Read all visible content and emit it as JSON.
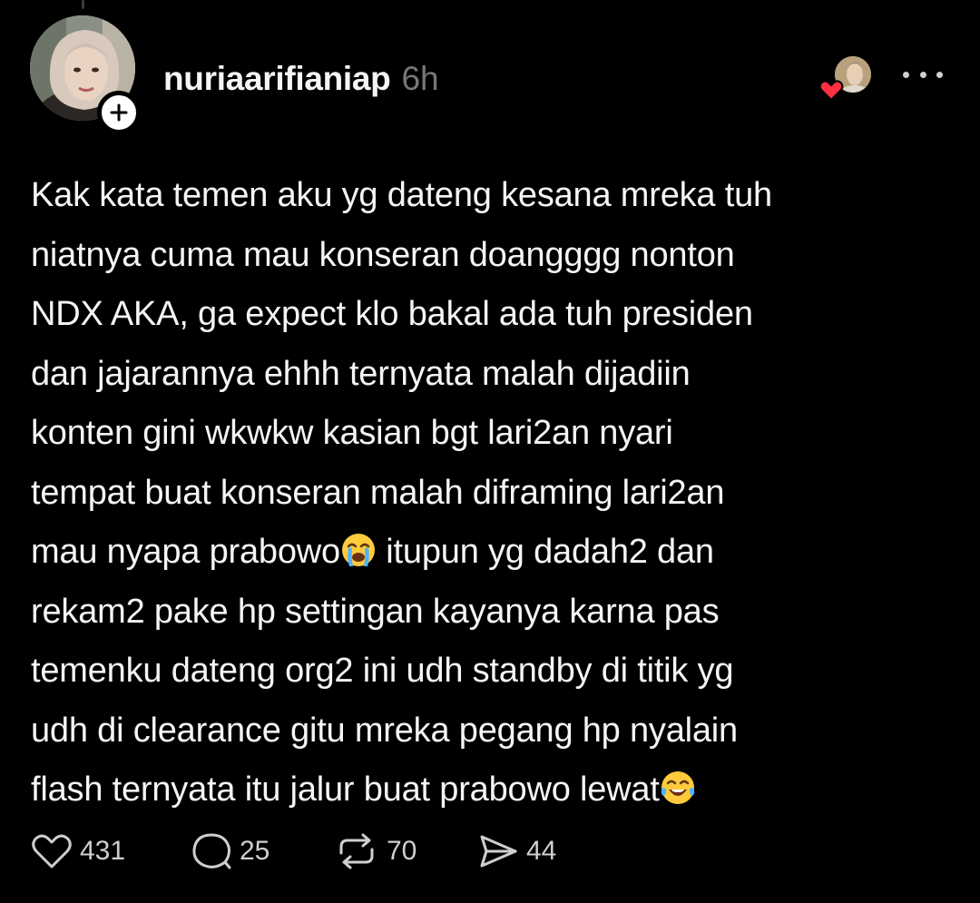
{
  "post": {
    "author": {
      "username": "nuriaarifianiap",
      "timestamp": "6h"
    },
    "body_lines": [
      "Kak kata temen aku yg dateng kesana mreka tuh",
      "niatnya cuma mau konseran doangggg nonton",
      "NDX AKA, ga expect klo bakal ada tuh presiden",
      "dan jajarannya ehhh ternyata malah dijadiin",
      "konten gini wkwkw kasian bgt lari2an nyari",
      "tempat buat konseran malah diframing lari2an",
      "mau nyapa prabowo",
      " itupun yg dadah2 dan",
      "rekam2 pake hp settingan kayanya karna pas",
      "temenku dateng org2 ini udh standby di titik yg",
      "udh di clearance gitu mreka pegang hp nyalain",
      "flash ternyata itu jalur buat prabowo lewat"
    ],
    "emojis": {
      "crying": "loudly-crying-face-emoji",
      "laughing": "face-with-tears-of-joy-emoji"
    },
    "actions": {
      "likes": "431",
      "replies": "25",
      "reposts": "70",
      "shares": "44"
    }
  },
  "icons": {
    "like": "heart-outline-icon",
    "reply": "speech-bubble-icon",
    "repost": "repost-arrows-icon",
    "share": "paper-plane-icon",
    "more": "more-horizontal-icon",
    "follow": "plus-icon"
  },
  "colors": {
    "background": "#000000",
    "text": "#f3f5f7",
    "muted": "#777777",
    "heart": "#ff3040"
  }
}
